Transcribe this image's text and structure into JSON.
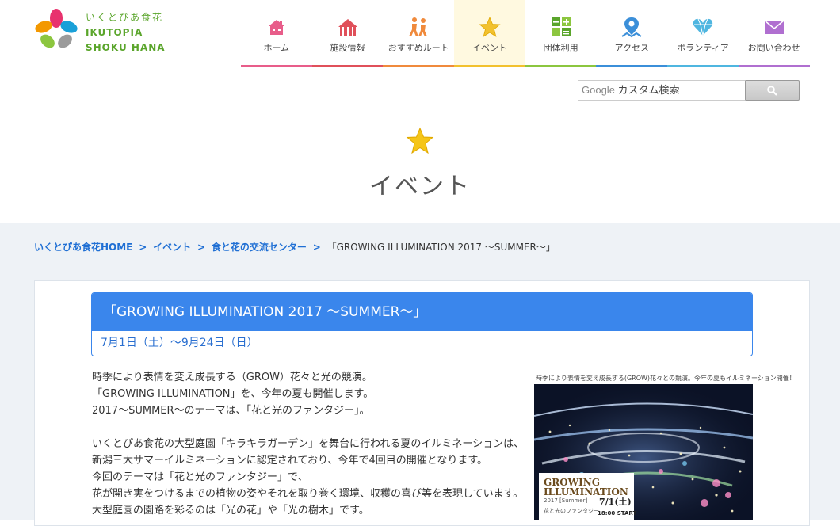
{
  "logo": {
    "name_kana": "いくとぴあ食花",
    "name_en_1": "IKUTOPIA",
    "name_en_2": "SHOKU HANA"
  },
  "nav": [
    {
      "label": "ホーム",
      "icon": "home-icon",
      "color": "#e85d8a"
    },
    {
      "label": "施設情報",
      "icon": "tent-icon",
      "color": "#e0505a"
    },
    {
      "label": "おすすめルート",
      "icon": "walking-people-icon",
      "color": "#f08a3c"
    },
    {
      "label": "イベント",
      "icon": "star-icon",
      "color": "#f2c12e",
      "active": true
    },
    {
      "label": "団体利用",
      "icon": "calculator-icon",
      "color": "#8cc63f"
    },
    {
      "label": "アクセス",
      "icon": "map-pin-icon",
      "color": "#3b8fd9"
    },
    {
      "label": "ボランティア",
      "icon": "heart-gem-icon",
      "color": "#4fb6e0"
    },
    {
      "label": "お問い合わせ",
      "icon": "envelope-icon",
      "color": "#b06fd0"
    }
  ],
  "search": {
    "brand": "Google",
    "placeholder": "カスタム検索"
  },
  "page": {
    "title": "イベント"
  },
  "breadcrumb": {
    "home": "いくとぴあ食花HOME",
    "events": "イベント",
    "center": "食と花の交流センター",
    "current": "「GROWING ILLUMINATION 2017 ～SUMMER～」",
    "sep": ">"
  },
  "event": {
    "title": "「GROWING ILLUMINATION 2017 ～SUMMER～」",
    "date": "7月1日（土）～9月24日（日）",
    "p1": [
      "時季により表情を変え成長する（GROW）花々と光の競演。",
      "「GROWING ILLUMINATION」を、今年の夏も開催します。",
      "2017～SUMMER～のテーマは、「花と光のファンタジー」。"
    ],
    "p2": [
      "いくとぴあ食花の大型庭園「キラキラガーデン」を舞台に行われる夏のイルミネーションは、",
      "新潟三大サマーイルミネーションに認定されており、今年で4回目の開催となります。",
      "今回のテーマは「花と光のファンタジー」で、",
      "花が開き実をつけるまでの植物の姿やそれを取り巻く環境、収穫の喜び等を表現しています。",
      "大型庭園の園路を彩るのは「光の花」や「光の樹木」です。"
    ]
  },
  "poster": {
    "caption": "時季により表情を変え成長する(GROW)花々との競演。今年の夏もイルミネーション開催！",
    "logo_line1": "GROWING",
    "logo_line2": "ILLUMINATION",
    "year": "2017 [Summer]",
    "theme": "花と光のファンタジー",
    "date": "7/1(土)",
    "start": "18:00 START"
  }
}
